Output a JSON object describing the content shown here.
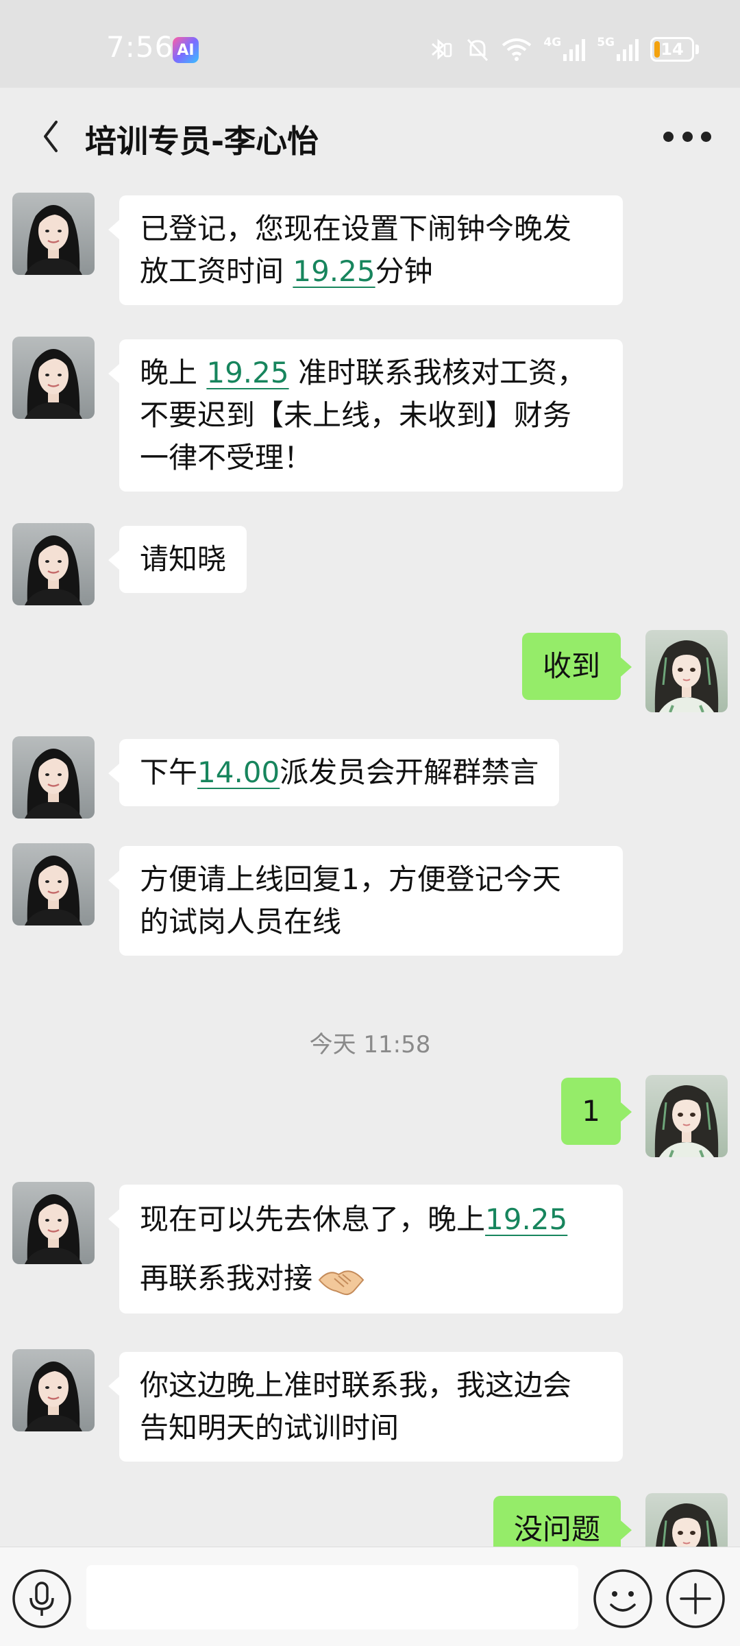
{
  "status_bar": {
    "time": "7:56",
    "ai_badge": "AI",
    "network_4g": "4G",
    "network_5g": "5G",
    "battery": "14"
  },
  "header": {
    "title": "培训专员-李心怡"
  },
  "messages": [
    {
      "side": "left",
      "parts": [
        "已登记，您现在设置下闹钟今晚发",
        "放工资时间 ",
        "19.25",
        "分钟"
      ]
    },
    {
      "side": "left",
      "parts": [
        "晚上 ",
        "19.25",
        " 准时联系我核对工资，",
        "不要迟到【未上线，未收到】财务",
        "一律不受理！"
      ]
    },
    {
      "side": "left",
      "parts": [
        "请知晓"
      ]
    },
    {
      "side": "right",
      "parts": [
        "收到"
      ]
    },
    {
      "side": "left",
      "parts": [
        "下午",
        "14.00",
        "派发员会开解群禁言"
      ]
    },
    {
      "side": "left",
      "parts": [
        "方便请上线回复1，方便登记今天",
        "的试岗人员在线"
      ]
    },
    {
      "side": "right",
      "parts": [
        "1"
      ]
    },
    {
      "side": "left",
      "parts": [
        "现在可以先去休息了，晚上",
        "19.25",
        "再联系我对接"
      ]
    },
    {
      "side": "left",
      "parts": [
        "你这边晚上准时联系我，我这边会",
        "告知明天的试训时间"
      ]
    },
    {
      "side": "right",
      "parts": [
        "没问题"
      ]
    }
  ],
  "timestamp": "今天 11:58",
  "colors": {
    "bubble_self": "#95ec69",
    "bubble_other": "#ffffff",
    "link": "#17855d",
    "background": "#ededed"
  },
  "icons": [
    "back-icon",
    "more-icon",
    "voice-icon",
    "emoji-icon",
    "plus-icon",
    "handshake-icon"
  ]
}
